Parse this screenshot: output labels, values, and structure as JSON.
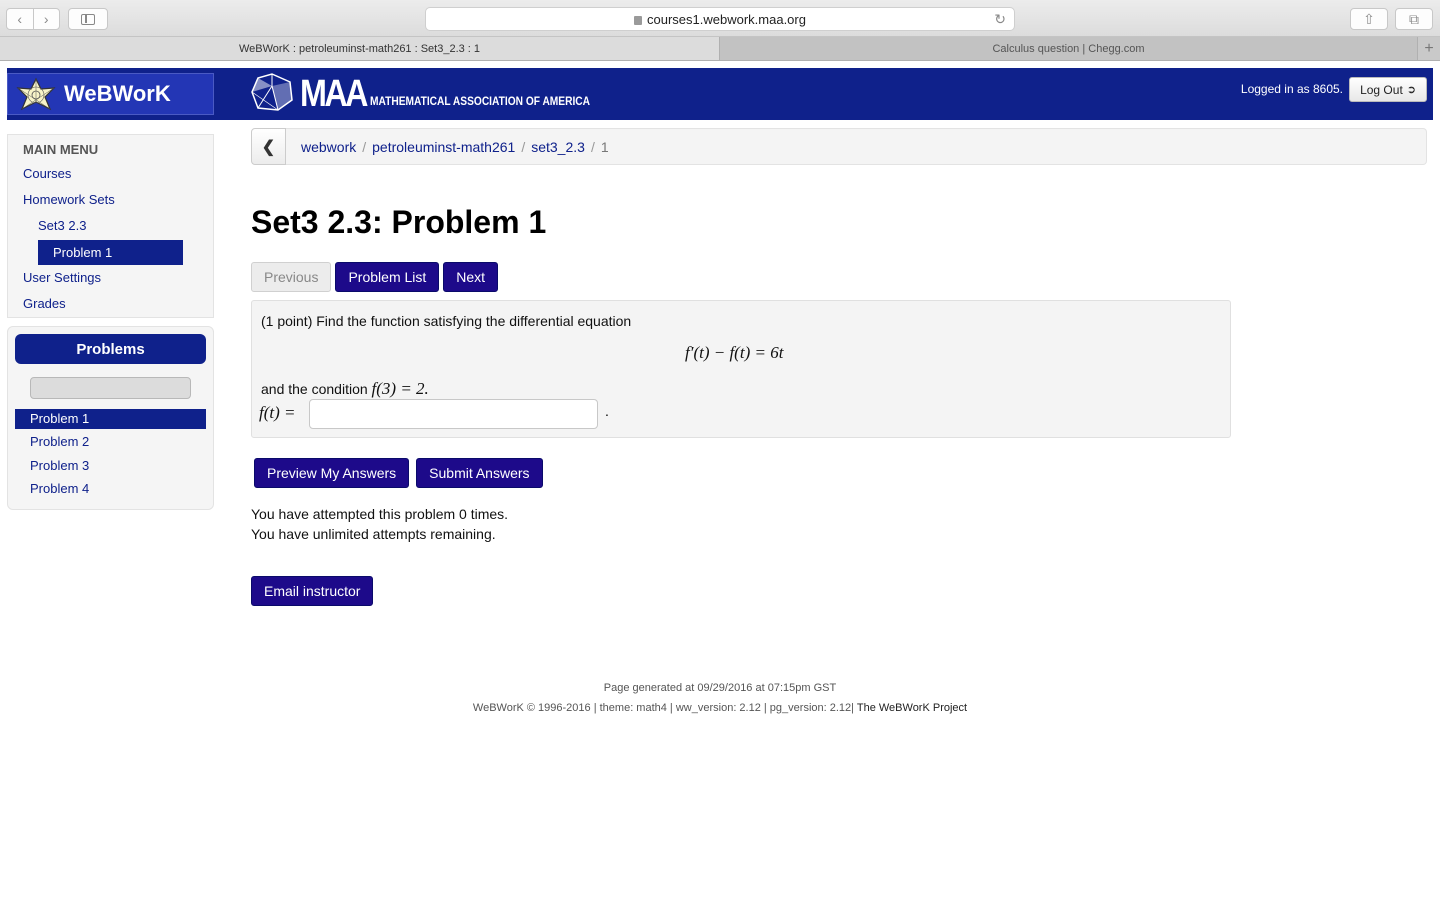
{
  "browser": {
    "url": "courses1.webwork.maa.org",
    "tabs": [
      {
        "label": "WeBWorK : petroleuminst-math261 : Set3_2.3 : 1",
        "active": true
      },
      {
        "label": "Calculus question | Chegg.com",
        "active": false
      }
    ]
  },
  "header": {
    "brand": "WeBWorK",
    "maa_short": "MAA",
    "maa_full": "MATHEMATICAL ASSOCIATION OF AMERICA",
    "login_text": "Logged in as 8605.",
    "logout_label": "Log Out",
    "colors": {
      "header_bg": "#0f218b",
      "logo_bg": "#2336b5"
    }
  },
  "sidebar": {
    "menu_title": "MAIN MENU",
    "items": [
      {
        "label": "Courses"
      },
      {
        "label": "Homework Sets"
      },
      {
        "label": "Set3 2.3"
      },
      {
        "label": "Problem 1",
        "active": true
      },
      {
        "label": "User Settings"
      },
      {
        "label": "Grades"
      }
    ],
    "problems_title": "Problems",
    "problems": [
      {
        "label": "Problem 1",
        "active": true
      },
      {
        "label": "Problem 2"
      },
      {
        "label": "Problem 3"
      },
      {
        "label": "Problem 4"
      }
    ]
  },
  "breadcrumb": {
    "items": [
      "webwork",
      "petroleuminst-math261",
      "set3_2.3"
    ],
    "current": "1",
    "separator": "/"
  },
  "page": {
    "title": "Set3 2.3: Problem 1",
    "nav": {
      "previous": "Previous",
      "problem_list": "Problem List",
      "next": "Next"
    },
    "problem": {
      "intro": "(1 point) Find the function satisfying the differential equation",
      "equation": "f′(t) − f(t) = 6t",
      "condition_prefix": "and the condition",
      "condition_math": "f(3) = 2.",
      "answer_label": "f(t) =",
      "answer_value": "",
      "answer_suffix": "."
    },
    "buttons": {
      "preview": "Preview My Answers",
      "submit": "Submit Answers",
      "email": "Email instructor"
    },
    "attempts_line1": "You have attempted this problem 0 times.",
    "attempts_line2": "You have unlimited attempts remaining."
  },
  "footer": {
    "generated": "Page generated at 09/29/2016 at 07:15pm GST",
    "copyright": "WeBWorK © 1996-2016 | theme: math4 | ww_version: 2.12 | pg_version: 2.12|",
    "project_link": "The WeBWorK Project"
  }
}
